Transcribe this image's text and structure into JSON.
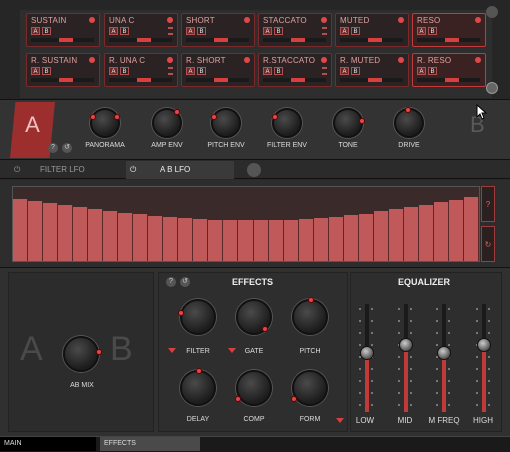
{
  "articulations": {
    "row1": [
      {
        "label": "SUSTAIN",
        "on": false
      },
      {
        "label": "UNA C",
        "on": false
      },
      {
        "label": "SHORT",
        "on": false
      },
      {
        "label": "STACCATO",
        "on": false
      },
      {
        "label": "MUTED",
        "on": false
      },
      {
        "label": "RESO",
        "on": true
      }
    ],
    "row2": [
      {
        "label": "R. SUSTAIN",
        "on": false
      },
      {
        "label": "R. UNA C",
        "on": false
      },
      {
        "label": "R. SHORT",
        "on": false
      },
      {
        "label": "R.STACCATO",
        "on": false
      },
      {
        "label": "R. MUTED",
        "on": false
      },
      {
        "label": "R. RESO",
        "on": true
      }
    ],
    "a_label": "A",
    "b_label": "B"
  },
  "ab_section": {
    "a_label": "A",
    "b_label": "B",
    "knobs": [
      "PANORAMA",
      "AMP ENV",
      "PITCH ENV",
      "FILTER ENV",
      "TONE",
      "DRIVE"
    ],
    "help": "?"
  },
  "tabs": {
    "filter_lfo": "FILTER LFO",
    "ab_lfo": "A B LFO",
    "power_icon": "⏻"
  },
  "lfo": {
    "levels": [
      0.84,
      0.81,
      0.78,
      0.76,
      0.73,
      0.7,
      0.67,
      0.65,
      0.63,
      0.61,
      0.59,
      0.58,
      0.57,
      0.56,
      0.55,
      0.55,
      0.55,
      0.55,
      0.56,
      0.57,
      0.58,
      0.6,
      0.62,
      0.64,
      0.67,
      0.7,
      0.73,
      0.76,
      0.8,
      0.83,
      0.86
    ],
    "side_top": "?",
    "side_bottom": "↻"
  },
  "mix": {
    "a": "A",
    "b": "B",
    "knob_label": "AB MIX"
  },
  "effects": {
    "title": "EFFECTS",
    "knobs": [
      "FILTER",
      "GATE",
      "PITCH",
      "DELAY",
      "COMP",
      "FORM"
    ],
    "help": "?"
  },
  "equalizer": {
    "title": "EQUALIZER",
    "bands": [
      {
        "label": "LOW",
        "level": 0.55
      },
      {
        "label": "MID",
        "level": 0.62
      },
      {
        "label": "M FREQ",
        "level": 0.55
      },
      {
        "label": "HIGH",
        "level": 0.62
      }
    ]
  },
  "status_bar": {
    "main": "MAIN",
    "effects": "EFFECTS"
  },
  "colors": {
    "accent": "#d84040",
    "panel": "#2e2e2e"
  }
}
